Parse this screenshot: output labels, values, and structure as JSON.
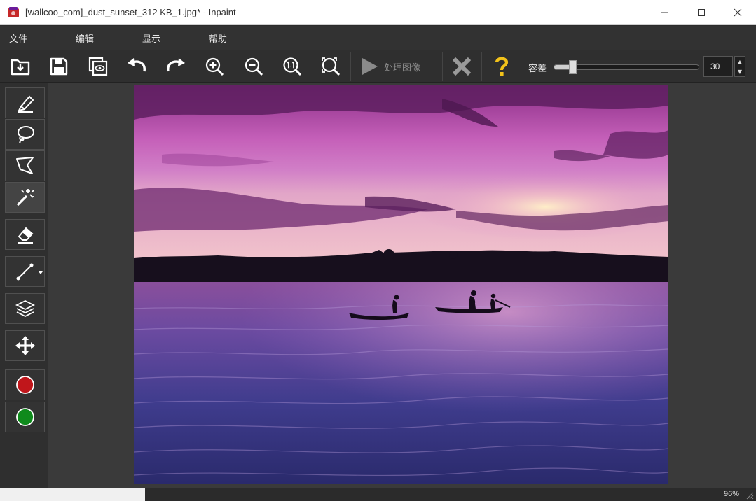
{
  "window": {
    "title": "[wallcoo_com]_dust_sunset_312 KB_1.jpg* - Inpaint",
    "minimize_glyph": "—",
    "maximize_glyph": "☐",
    "close_glyph": "✕"
  },
  "menu": {
    "items": [
      {
        "label": "文件"
      },
      {
        "label": "编辑"
      },
      {
        "label": "显示"
      },
      {
        "label": "帮助"
      }
    ]
  },
  "toolbar": {
    "process_label": "处理图像",
    "tolerance_label": "容差",
    "tolerance_value": "30",
    "icons": [
      "open-icon",
      "save-icon",
      "preview-icon",
      "undo-icon",
      "redo-icon",
      "zoom-in-icon",
      "zoom-out-icon",
      "zoom-actual-icon",
      "zoom-fit-icon",
      "play-icon",
      "cancel-icon",
      "help-icon"
    ]
  },
  "tools": {
    "icons": [
      "marker-icon",
      "lasso-icon",
      "polygonal-lasso-icon",
      "magic-wand-icon",
      "eraser-icon",
      "line-icon",
      "layers-icon",
      "move-icon",
      "red-color-swatch",
      "green-color-swatch"
    ],
    "active": "magic-wand-icon"
  },
  "colors": {
    "accent_help": "#f2c21a",
    "swatch_red": "#c0161b",
    "swatch_green": "#0f8a1c",
    "cancel_gray": "#9a9a9a"
  },
  "status": {
    "zoom": "96%"
  }
}
